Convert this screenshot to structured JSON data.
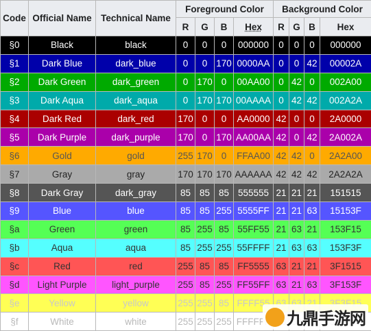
{
  "headers": {
    "code": "Code",
    "official": "Official Name",
    "technical": "Technical Name",
    "foreground": "Foreground Color",
    "background": "Background Color",
    "r": "R",
    "g": "G",
    "b": "B",
    "hex": "Hex"
  },
  "rows": [
    {
      "code": "§0",
      "official": "Black",
      "technical": "black",
      "fr": "0",
      "fg": "0",
      "fb": "0",
      "fhex": "000000",
      "br": "0",
      "bg": "0",
      "bb": "0",
      "bhex": "000000",
      "color": "#000000",
      "text": "#ffffff"
    },
    {
      "code": "§1",
      "official": "Dark Blue",
      "technical": "dark_blue",
      "fr": "0",
      "fg": "0",
      "fb": "170",
      "fhex": "0000AA",
      "br": "0",
      "bg": "0",
      "bb": "42",
      "bhex": "00002A",
      "color": "#0000aa",
      "text": "#ffffff"
    },
    {
      "code": "§2",
      "official": "Dark Green",
      "technical": "dark_green",
      "fr": "0",
      "fg": "170",
      "fb": "0",
      "fhex": "00AA00",
      "br": "0",
      "bg": "42",
      "bb": "0",
      "bhex": "002A00",
      "color": "#00aa00",
      "text": "#ffffff"
    },
    {
      "code": "§3",
      "official": "Dark Aqua",
      "technical": "dark_aqua",
      "fr": "0",
      "fg": "170",
      "fb": "170",
      "fhex": "00AAAA",
      "br": "0",
      "bg": "42",
      "bb": "42",
      "bhex": "002A2A",
      "color": "#00aaaa",
      "text": "#ffffff"
    },
    {
      "code": "§4",
      "official": "Dark Red",
      "technical": "dark_red",
      "fr": "170",
      "fg": "0",
      "fb": "0",
      "fhex": "AA0000",
      "br": "42",
      "bg": "0",
      "bb": "0",
      "bhex": "2A0000",
      "color": "#aa0000",
      "text": "#ffffff"
    },
    {
      "code": "§5",
      "official": "Dark Purple",
      "technical": "dark_purple",
      "fr": "170",
      "fg": "0",
      "fb": "170",
      "fhex": "AA00AA",
      "br": "42",
      "bg": "0",
      "bb": "42",
      "bhex": "2A002A",
      "color": "#aa00aa",
      "text": "#ffffff"
    },
    {
      "code": "§6",
      "official": "Gold",
      "technical": "gold",
      "fr": "255",
      "fg": "170",
      "fb": "0",
      "fhex": "FFAA00",
      "br": "42",
      "bg": "42",
      "bb": "0",
      "bhex": "2A2A00",
      "color": "#ffaa00",
      "text": "#555555"
    },
    {
      "code": "§7",
      "official": "Gray",
      "technical": "gray",
      "fr": "170",
      "fg": "170",
      "fb": "170",
      "fhex": "AAAAAA",
      "br": "42",
      "bg": "42",
      "bb": "42",
      "bhex": "2A2A2A",
      "color": "#aaaaaa",
      "text": "#222222"
    },
    {
      "code": "§8",
      "official": "Dark Gray",
      "technical": "dark_gray",
      "fr": "85",
      "fg": "85",
      "fb": "85",
      "fhex": "555555",
      "br": "21",
      "bg": "21",
      "bb": "21",
      "bhex": "151515",
      "color": "#555555",
      "text": "#ffffff"
    },
    {
      "code": "§9",
      "official": "Blue",
      "technical": "blue",
      "fr": "85",
      "fg": "85",
      "fb": "255",
      "fhex": "5555FF",
      "br": "21",
      "bg": "21",
      "bb": "63",
      "bhex": "15153F",
      "color": "#5555ff",
      "text": "#ffffff"
    },
    {
      "code": "§a",
      "official": "Green",
      "technical": "green",
      "fr": "85",
      "fg": "255",
      "fb": "85",
      "fhex": "55FF55",
      "br": "21",
      "bg": "63",
      "bb": "21",
      "bhex": "153F15",
      "color": "#55ff55",
      "text": "#333333"
    },
    {
      "code": "§b",
      "official": "Aqua",
      "technical": "aqua",
      "fr": "85",
      "fg": "255",
      "fb": "255",
      "fhex": "55FFFF",
      "br": "21",
      "bg": "63",
      "bb": "63",
      "bhex": "153F3F",
      "color": "#55ffff",
      "text": "#333333"
    },
    {
      "code": "§c",
      "official": "Red",
      "technical": "red",
      "fr": "255",
      "fg": "85",
      "fb": "85",
      "fhex": "FF5555",
      "br": "63",
      "bg": "21",
      "bb": "21",
      "bhex": "3F1515",
      "color": "#ff5555",
      "text": "#333333"
    },
    {
      "code": "§d",
      "official": "Light Purple",
      "technical": "light_purple",
      "fr": "255",
      "fg": "85",
      "fb": "255",
      "fhex": "FF55FF",
      "br": "63",
      "bg": "21",
      "bb": "63",
      "bhex": "3F153F",
      "color": "#ff55ff",
      "text": "#333333"
    },
    {
      "code": "§e",
      "official": "Yellow",
      "technical": "yellow",
      "fr": "255",
      "fg": "255",
      "fb": "85",
      "fhex": "FFFF55",
      "br": "63",
      "bg": "63",
      "bb": "21",
      "bhex": "3F3F15",
      "color": "#ffff55",
      "text": "#c8c8c8"
    },
    {
      "code": "§f",
      "official": "White",
      "technical": "white",
      "fr": "255",
      "fg": "255",
      "fb": "255",
      "fhex": "FFFFFF",
      "br": "63",
      "bg": "63",
      "bb": "63",
      "bhex": "3F3F3F",
      "color": "#ffffff",
      "text": "#b8b8b8"
    }
  ],
  "watermark": {
    "logo": "九",
    "text": "九鼎手游网"
  }
}
